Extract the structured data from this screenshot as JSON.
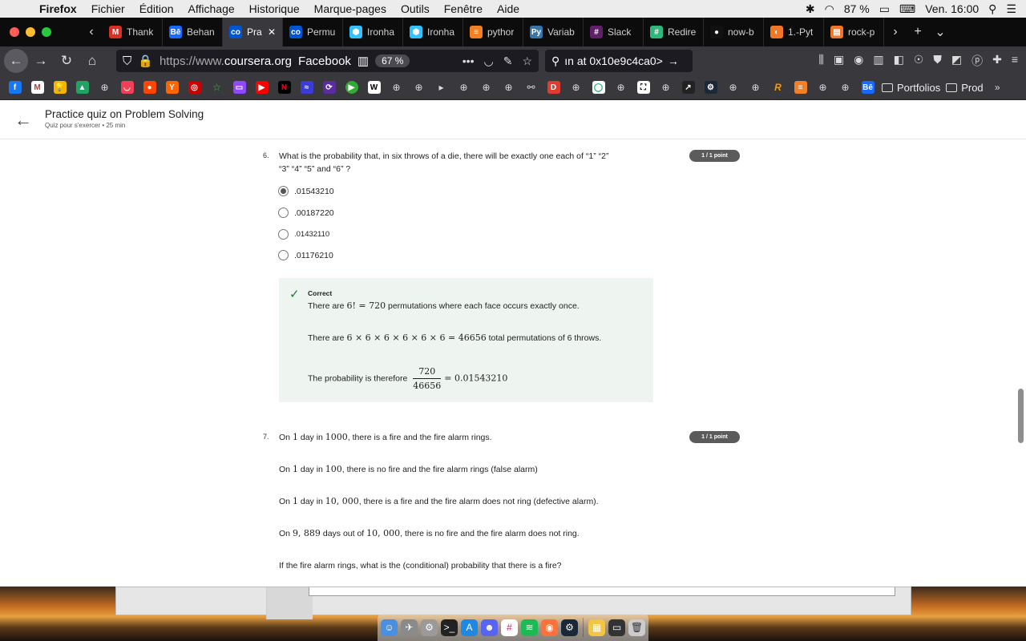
{
  "menubar": {
    "app": "Firefox",
    "items": [
      "Fichier",
      "Édition",
      "Affichage",
      "Historique",
      "Marque-pages",
      "Outils",
      "Fenêtre",
      "Aide"
    ],
    "battery": "87 %",
    "clock": "Ven. 16:00"
  },
  "tabs": [
    {
      "label": "Thank",
      "icon": "gmail-icon",
      "color": "#d93025",
      "glyph": "M"
    },
    {
      "label": "Behan",
      "icon": "behance-icon",
      "color": "#1769ff",
      "glyph": "Bē"
    },
    {
      "label": "Pra",
      "icon": "coursera-icon",
      "color": "#0056d2",
      "glyph": "co",
      "active": true
    },
    {
      "label": "Permu",
      "icon": "coursera-icon",
      "color": "#0056d2",
      "glyph": "co"
    },
    {
      "label": "Ironha",
      "icon": "ironhack-icon",
      "color": "#32c3ff",
      "glyph": "⬢"
    },
    {
      "label": "Ironha",
      "icon": "ironhack-icon",
      "color": "#32c3ff",
      "glyph": "⬢"
    },
    {
      "label": "pythor",
      "icon": "stackoverflow-icon",
      "color": "#f48024",
      "glyph": "≡"
    },
    {
      "label": "Variab",
      "icon": "python-icon",
      "color": "#3776ab",
      "glyph": "Py"
    },
    {
      "label": "Slack",
      "icon": "slack-icon",
      "color": "#611f69",
      "glyph": "#"
    },
    {
      "label": "Redire",
      "icon": "slack-icon",
      "color": "#2eb67d",
      "glyph": "#"
    },
    {
      "label": "now-b",
      "icon": "github-icon",
      "color": "#111",
      "glyph": "●"
    },
    {
      "label": "1.-Pyt",
      "icon": "jupyter-icon",
      "color": "#f37626",
      "glyph": "◐"
    },
    {
      "label": "rock-p",
      "icon": "notebook-icon",
      "color": "#f37626",
      "glyph": "▤"
    }
  ],
  "navbar": {
    "url_prefix": "https://www.",
    "url_domain": "coursera.org",
    "page_title": "Facebook",
    "zoom": "67 %",
    "search_text": "ın at 0x10e9c4ca0>"
  },
  "bookmarks": {
    "folders": [
      "Portfolios",
      "Prod"
    ]
  },
  "quiz": {
    "title": "Practice quiz on Problem Solving",
    "meta": "Quiz pour s'exercer • 25  min"
  },
  "q6": {
    "number": "6.",
    "text_line1": "What is the probability that, in six throws of a die, there will be exactly one each of “1”  “2”",
    "text_line2": "“3”  “4”  “5”  and  “6” ?",
    "badge": "1 / 1 point",
    "options": [
      ".01543210",
      ".00187220",
      ".01432110",
      ".01176210"
    ],
    "selected_index": 0,
    "feedback": {
      "label": "Correct",
      "line1_pre": "There are ",
      "line1_math": "6! = 720",
      "line1_post": " permutations where each face occurs exactly once.",
      "line2_pre": "There are ",
      "line2_math": "6 × 6 × 6 × 6 × 6 × 6 = 46656",
      "line2_post": " total permutations of 6 throws.",
      "line3_pre": "The probability is therefore ",
      "frac_num": "720",
      "frac_den": "46656",
      "line3_post": "= 0.01543210"
    }
  },
  "q7": {
    "number": "7.",
    "badge": "1 / 1 point",
    "line1_a": "On ",
    "line1_m1": "1",
    "line1_b": " day in ",
    "line1_m2": "1000",
    "line1_c": ", there is a fire and the fire alarm rings.",
    "line2_a": "On ",
    "line2_m1": "1",
    "line2_b": " day in ",
    "line2_m2": "100",
    "line2_c": ", there is no fire and the fire alarm rings (false alarm)",
    "line3_a": "On ",
    "line3_m1": "1",
    "line3_b": " day in ",
    "line3_m2": "10, 000",
    "line3_c": ", there is a fire and the fire alarm does not ring (defective alarm).",
    "line4_a": "On ",
    "line4_m1": "9, 889",
    "line4_b": " days out of ",
    "line4_m2": "10, 000",
    "line4_c": ", there is no fire and the fire alarm does not ring.",
    "line5": "If the fire alarm rings, what is the (conditional) probability that there is a fire?"
  }
}
